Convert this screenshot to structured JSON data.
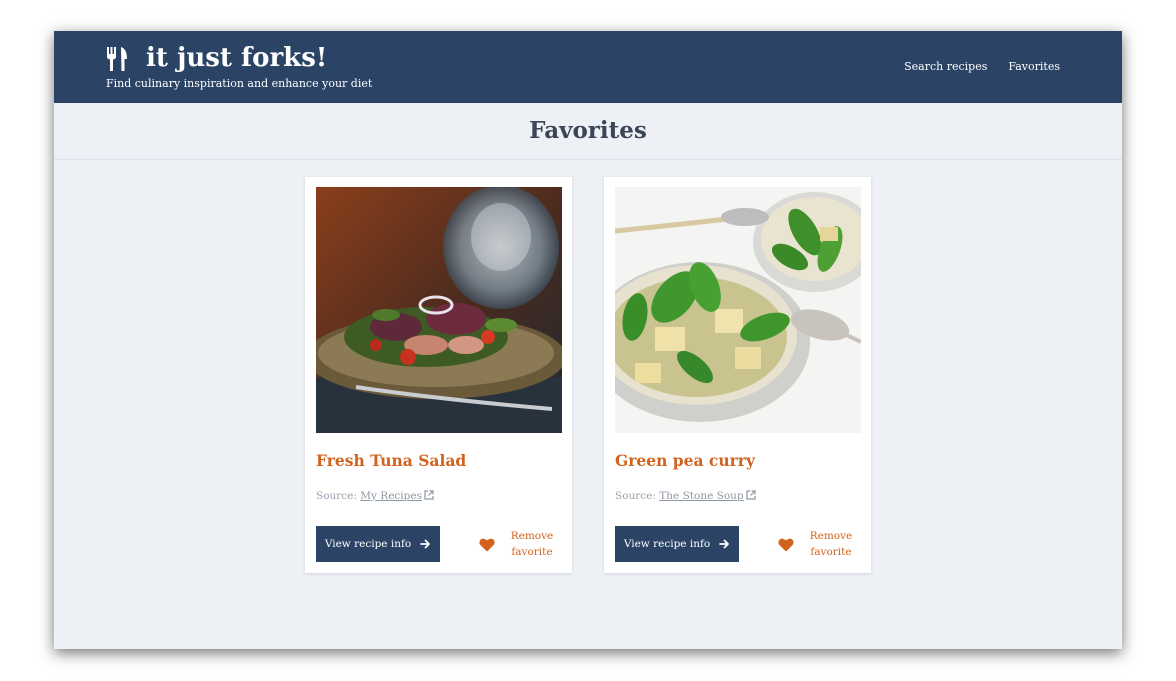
{
  "header": {
    "title": "it just forks!",
    "tagline": "Find culinary inspiration and enhance your diet",
    "nav": {
      "search": "Search recipes",
      "favorites": "Favorites"
    }
  },
  "page": {
    "heading": "Favorites"
  },
  "recipes": [
    {
      "title": "Fresh Tuna Salad",
      "source_label": "Source:",
      "source_name": "My Recipes",
      "view_label": "View recipe info",
      "remove_line1": "Remove",
      "remove_line2": "favorite"
    },
    {
      "title": "Green pea curry",
      "source_label": "Source:",
      "source_name": "The Stone Soup",
      "view_label": "View recipe info",
      "remove_line1": "Remove",
      "remove_line2": "favorite"
    }
  ],
  "colors": {
    "header_bg": "#2b4466",
    "page_bg": "#edf1f5",
    "accent": "#d2631f",
    "button_bg": "#2b4466"
  },
  "icons": {
    "logo": "fork-knife-icon",
    "external": "external-link-icon",
    "arrow": "arrow-right-icon",
    "favorite": "heart-icon"
  }
}
